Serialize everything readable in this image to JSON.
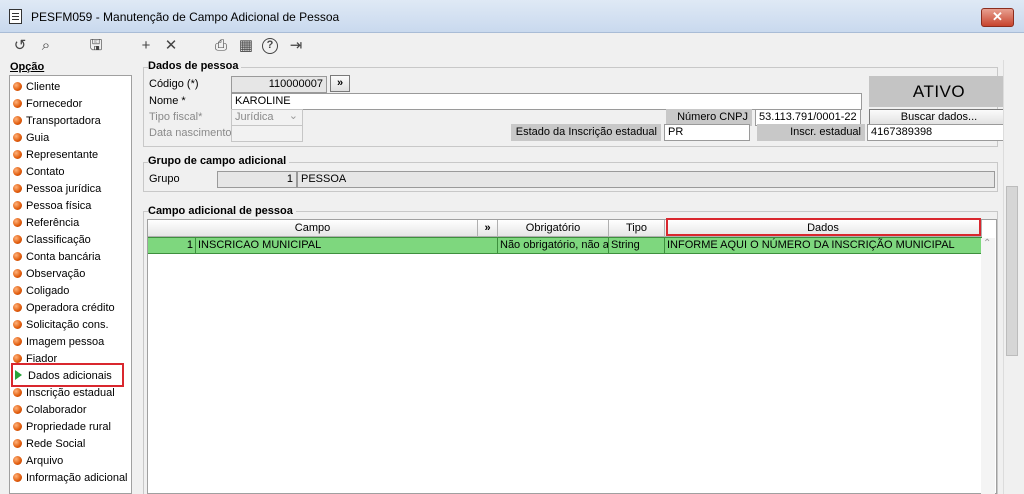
{
  "window": {
    "title": "PESFM059 - Manutenção de Campo Adicional de Pessoa",
    "close_label": "✕"
  },
  "toolbar": {
    "icons": [
      "undo-icon",
      "search-icon",
      "save-icon",
      "add-icon",
      "delete-icon",
      "print-icon",
      "calendar-icon",
      "help-icon",
      "exit-icon"
    ],
    "undo": "↺",
    "search": "⌕",
    "save": "🖫",
    "add": "+",
    "delete": "✕",
    "print": "⎙",
    "calendar": "▦",
    "help": "?",
    "exit": "⇥"
  },
  "options": {
    "label": "Opção",
    "items": [
      "Cliente",
      "Fornecedor",
      "Transportadora",
      "Guia",
      "Representante",
      "Contato",
      "Pessoa jurídica",
      "Pessoa física",
      "Referência",
      "Classificação",
      "Conta bancária",
      "Observação",
      "Coligado",
      "Operadora crédito",
      "Solicitação cons.",
      "Imagem pessoa",
      "Fiador",
      "Dados adicionais",
      "Inscrição estadual",
      "Colaborador",
      "Propriedade rural",
      "Rede Social",
      "Arquivo",
      "Informação adicional"
    ],
    "selected": "Dados adicionais"
  },
  "dados_pessoa": {
    "title": "Dados de pessoa",
    "codigo_label": "Código (*)",
    "codigo_value": "110000007",
    "nav_button": "»",
    "nome_label": "Nome *",
    "nome_value": "KAROLINE",
    "tipo_fiscal_label": "Tipo fiscal*",
    "tipo_fiscal_value": "Jurídica",
    "data_nascimento_label": "Data nascimento",
    "data_nascimento_value": "",
    "cnpj_label": "Número CNPJ",
    "cnpj_value": "53.113.791/0001-22",
    "buscar_button": "Buscar dados...",
    "estado_ie_label": "Estado da Inscrição estadual",
    "estado_ie_value": "PR",
    "inscr_estadual_label": "Inscr. estadual",
    "inscr_estadual_value": "4167389398",
    "status": "ATIVO"
  },
  "grupo": {
    "title": "Grupo de campo adicional",
    "label": "Grupo",
    "code": "1",
    "name": "PESSOA"
  },
  "campo_adicional": {
    "title": "Campo adicional de pessoa",
    "headers": {
      "campo": "Campo",
      "nav": "»",
      "obrigatorio": "Obrigatório",
      "tipo": "Tipo",
      "dados": "Dados"
    },
    "rows": [
      {
        "num": "1",
        "campo": "INSCRICAO MUNICIPAL",
        "obrigatorio": "Não obrigatório, não a",
        "tipo": "String",
        "dados": "INFORME AQUI O NÚMERO DA INSCRIÇÃO MUNICIPAL"
      }
    ]
  },
  "colors": {
    "row_selected": "#7ed77e",
    "highlight_border": "#d9272e",
    "option_dot": "#e05a0a"
  }
}
